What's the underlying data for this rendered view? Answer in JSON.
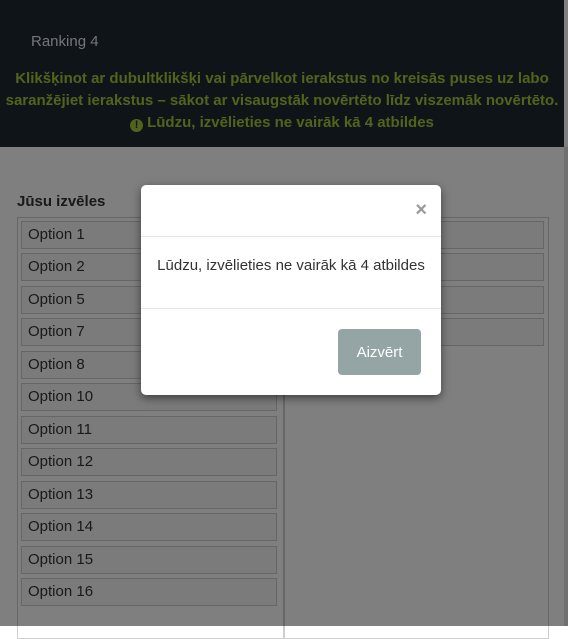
{
  "header": {
    "title": "Ranking 4",
    "instruction_line1": "Klikšķinot ar dubultklikšķi vai pārvelkot ierakstus no kreisās puses uz labo",
    "instruction_line2": "saranžējiet ierakstus – sākot ar visaugstāk novērtēto līdz viszemāk novērtēto.",
    "warning_icon": "exclamation-circle-icon",
    "warning_text": "Lūdzu, izvēlieties ne vairāk kā 4 atbildes",
    "bg_color": "#1f2833",
    "accent_color": "#a4c639"
  },
  "left_column": {
    "heading": "Jūsu izvēles",
    "items": [
      "Option 1",
      "Option 2",
      "Option 5",
      "Option 7",
      "Option 8",
      "Option 10",
      "Option 11",
      "Option 12",
      "Option 13",
      "Option 14",
      "Option 15",
      "Option 16"
    ]
  },
  "modal": {
    "close_symbol": "×",
    "message": "Lūdzu, izvēlieties ne vairāk kā 4 atbildes",
    "button_label": "Aizvērt",
    "button_color": "#95a5a6"
  }
}
